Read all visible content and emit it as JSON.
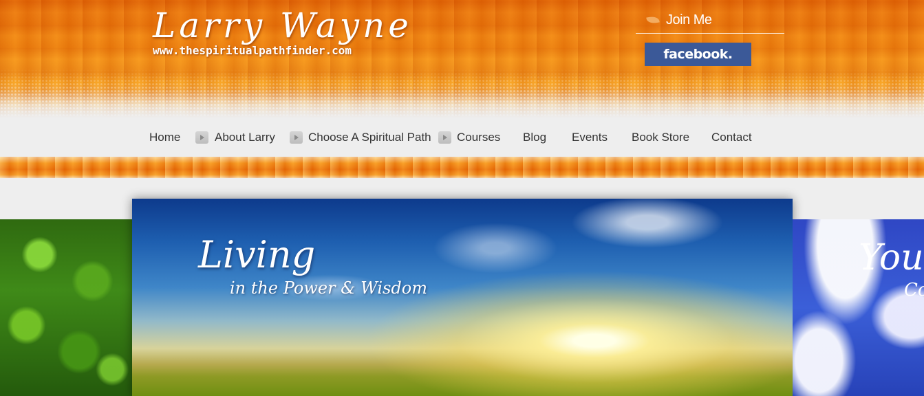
{
  "site": {
    "title": "Larry Wayne",
    "url": "www.thespiritualpathfinder.com"
  },
  "social": {
    "join_label": "Join Me",
    "facebook_label": "facebook."
  },
  "nav": {
    "items": [
      {
        "label": "Home",
        "has_submenu": false
      },
      {
        "label": "About Larry",
        "has_submenu": true
      },
      {
        "label": "Choose A Spiritual Path",
        "has_submenu": true
      },
      {
        "label": "Courses",
        "has_submenu": true
      },
      {
        "label": "Blog",
        "has_submenu": false
      },
      {
        "label": "Events",
        "has_submenu": false
      },
      {
        "label": "Book Store",
        "has_submenu": false
      },
      {
        "label": "Contact",
        "has_submenu": false
      }
    ]
  },
  "slider": {
    "main": {
      "headline": "Living",
      "subline": "in the Power & Wisdom"
    },
    "next": {
      "headline": "Your",
      "subline": "Co"
    }
  },
  "colors": {
    "accent_orange": "#f58a10",
    "nav_background": "#eeeeee",
    "facebook_blue": "#3b5998"
  }
}
